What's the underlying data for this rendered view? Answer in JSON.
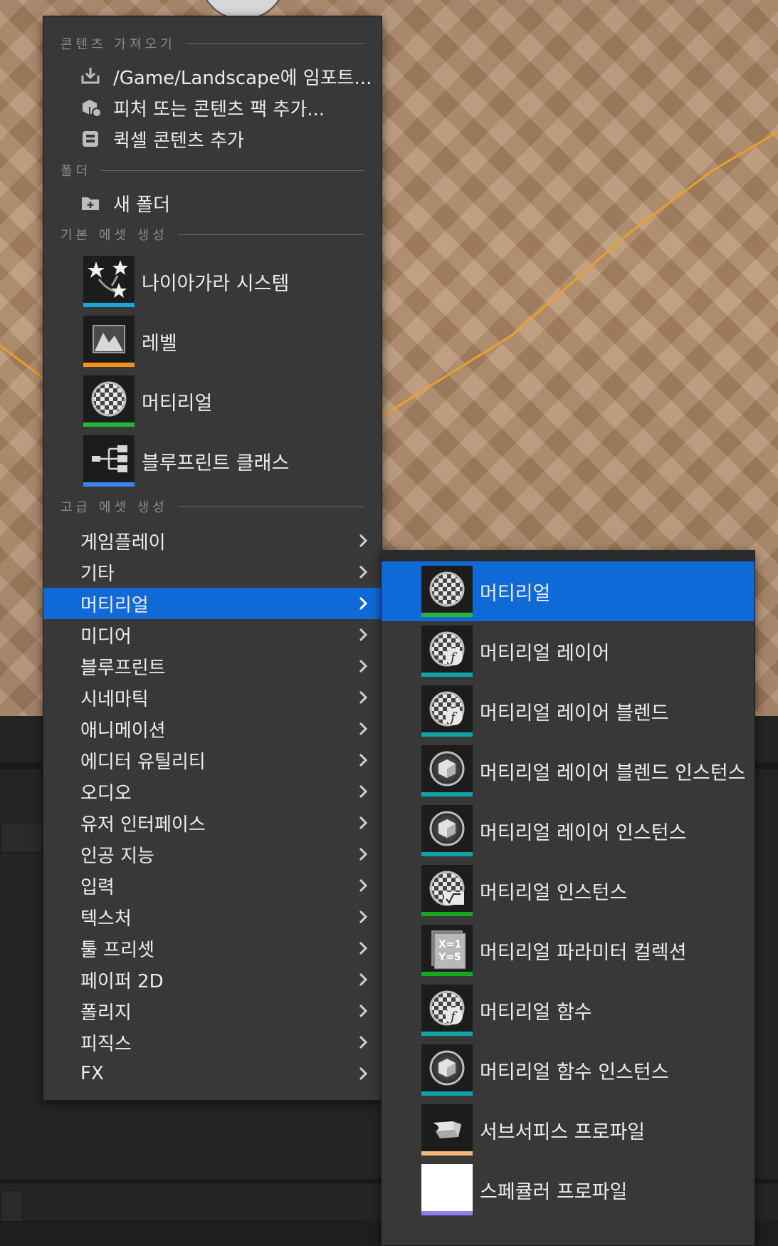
{
  "colors": {
    "menu_bg": "#383838",
    "highlight": "#0f6ad8",
    "text": "#ececec",
    "section_text": "#8c8c8c",
    "bar_niagara": "#1aa6d8",
    "bar_level": "#f39420",
    "bar_material": "#27b43a",
    "bar_blueprint": "#3a86f0",
    "bar_teal": "#12a4a4",
    "bar_green": "#14a820",
    "bar_orange_light": "#f4b878",
    "bar_purple": "#8e7cf4"
  },
  "main_menu": {
    "sections": {
      "import": "콘텐츠 가져오기",
      "folder": "폴더",
      "basic": "기본 에셋 생성",
      "advanced": "고급 에셋 생성"
    },
    "import_items": [
      {
        "label": "/Game/Landscape에 임포트...",
        "icon": "import-icon"
      },
      {
        "label": "피처 또는 콘텐츠 팩 추가...",
        "icon": "content-pack-icon"
      },
      {
        "label": "퀵셀 콘텐츠 추가",
        "icon": "quixel-icon"
      }
    ],
    "folder_items": [
      {
        "label": "새 폴더",
        "icon": "new-folder-icon"
      }
    ],
    "basic_items": [
      {
        "label": "나이아가라 시스템",
        "icon": "niagara-system-icon",
        "bar": "#1aa6d8"
      },
      {
        "label": "레벨",
        "icon": "level-icon",
        "bar": "#f39420"
      },
      {
        "label": "머티리얼",
        "icon": "material-icon",
        "bar": "#27b43a"
      },
      {
        "label": "블루프린트 클래스",
        "icon": "blueprint-class-icon",
        "bar": "#3a86f0"
      }
    ],
    "categories": [
      {
        "label": "게임플레이"
      },
      {
        "label": "기타"
      },
      {
        "label": "머티리얼",
        "active": true
      },
      {
        "label": "미디어"
      },
      {
        "label": "블루프린트"
      },
      {
        "label": "시네마틱"
      },
      {
        "label": "애니메이션"
      },
      {
        "label": "에디터 유틸리티"
      },
      {
        "label": "오디오"
      },
      {
        "label": "유저 인터페이스"
      },
      {
        "label": "인공 지능"
      },
      {
        "label": "입력"
      },
      {
        "label": "텍스처"
      },
      {
        "label": "툴 프리셋"
      },
      {
        "label": "페이퍼 2D"
      },
      {
        "label": "폴리지"
      },
      {
        "label": "피직스"
      },
      {
        "label": "FX"
      }
    ]
  },
  "sub_menu": {
    "items": [
      {
        "label": "머티리얼",
        "icon": "material-icon",
        "bar": "#27b43a",
        "active": true
      },
      {
        "label": "머티리얼 레이어",
        "icon": "material-layer-icon",
        "bar": "#12a4a4"
      },
      {
        "label": "머티리얼 레이어 블렌드",
        "icon": "material-layer-blend-icon",
        "bar": "#12a4a4"
      },
      {
        "label": "머티리얼 레이어 블렌드 인스턴스",
        "icon": "material-layer-blend-instance-icon",
        "bar": "#12a4a4"
      },
      {
        "label": "머티리얼 레이어 인스턴스",
        "icon": "material-layer-instance-icon",
        "bar": "#12a4a4"
      },
      {
        "label": "머티리얼 인스턴스",
        "icon": "material-instance-icon",
        "bar": "#14a820"
      },
      {
        "label": "머티리얼 파라미터 컬렉션",
        "icon": "material-parameter-collection-icon",
        "bar": "#14a820",
        "glyph": [
          "X=1",
          "Y=5"
        ]
      },
      {
        "label": "머티리얼 함수",
        "icon": "material-function-icon",
        "bar": "#12a4a4"
      },
      {
        "label": "머티리얼 함수 인스턴스",
        "icon": "material-function-instance-icon",
        "bar": "#12a4a4"
      },
      {
        "label": "서브서피스 프로파일",
        "icon": "subsurface-profile-icon",
        "bar": "#f4b878"
      },
      {
        "label": "스페큘러 프로파일",
        "icon": "specular-profile-icon",
        "bar": "#8e7cf4"
      }
    ]
  }
}
